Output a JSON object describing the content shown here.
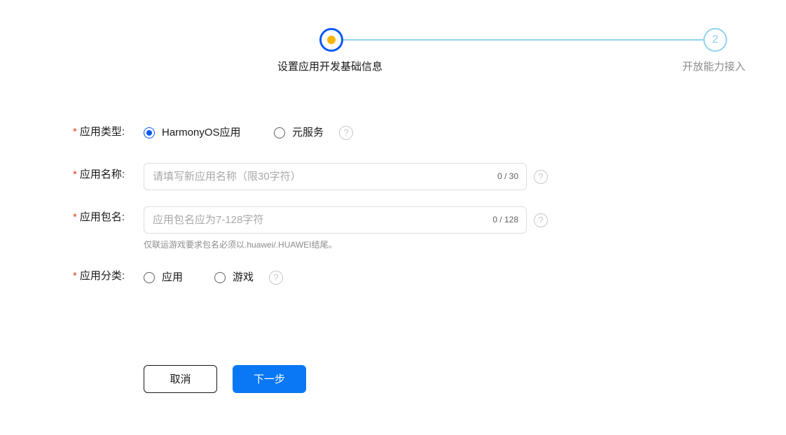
{
  "stepper": {
    "steps": [
      {
        "label": "设置应用开发基础信息",
        "state": "active"
      },
      {
        "label": "开放能力接入",
        "number": "2",
        "state": "pending"
      }
    ]
  },
  "form": {
    "app_type": {
      "label": "应用类型:",
      "required_mark": "*",
      "options": [
        {
          "label": "HarmonyOS应用",
          "checked": true
        },
        {
          "label": "元服务",
          "checked": false
        }
      ],
      "help_icon": "question-circle-icon",
      "help_glyph": "?"
    },
    "app_name": {
      "label": "应用名称:",
      "required_mark": "*",
      "value": "",
      "placeholder": "请填写新应用名称（限30字符）",
      "counter": "0 / 30",
      "help_icon": "question-circle-icon",
      "help_glyph": "?"
    },
    "package_name": {
      "label": "应用包名:",
      "required_mark": "*",
      "value": "",
      "placeholder": "应用包名应为7-128字符",
      "counter": "0 / 128",
      "hint": "仅联运游戏要求包名必须以.huawei/.HUAWEI结尾。",
      "help_icon": "question-circle-icon",
      "help_glyph": "?"
    },
    "app_category": {
      "label": "应用分类:",
      "required_mark": "*",
      "options": [
        {
          "label": "应用",
          "checked": false
        },
        {
          "label": "游戏",
          "checked": false
        }
      ],
      "help_icon": "question-circle-icon",
      "help_glyph": "?"
    }
  },
  "actions": {
    "cancel_label": "取消",
    "next_label": "下一步"
  },
  "colors": {
    "primary": "#0a59f7",
    "button_primary": "#0a78f5",
    "step_dot_active": "#f7b500",
    "step_line": "#8fd3ee",
    "required": "#e84026"
  }
}
